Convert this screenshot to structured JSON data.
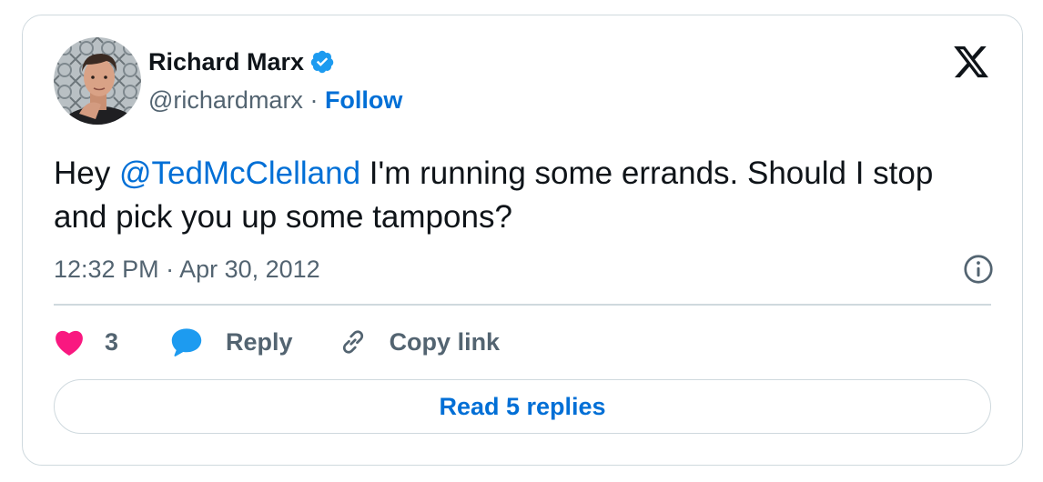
{
  "author": {
    "name": "Richard Marx",
    "handle": "@richardmarx",
    "separator": " · ",
    "follow_label": "Follow",
    "verified_icon": "verified-badge-icon",
    "avatar": "profile-photo"
  },
  "logo_icon": "x-logo-icon",
  "tweet": {
    "text_before": "Hey ",
    "mention": "@TedMcClelland",
    "text_after": " I'm running some errands. Should I stop and pick you up some tampons?"
  },
  "timestamp": "12:32 PM · Apr 30, 2012",
  "info_icon": "info-icon",
  "actions": {
    "like_count": "3",
    "reply_label": "Reply",
    "copy_label": "Copy link"
  },
  "read_replies_label": "Read 5 replies",
  "colors": {
    "accent": "#006fd6",
    "like": "#f91880",
    "reply_bubble": "#1d9bf0",
    "text": "#0f1419",
    "muted": "#536471",
    "border": "#cfd9de"
  }
}
